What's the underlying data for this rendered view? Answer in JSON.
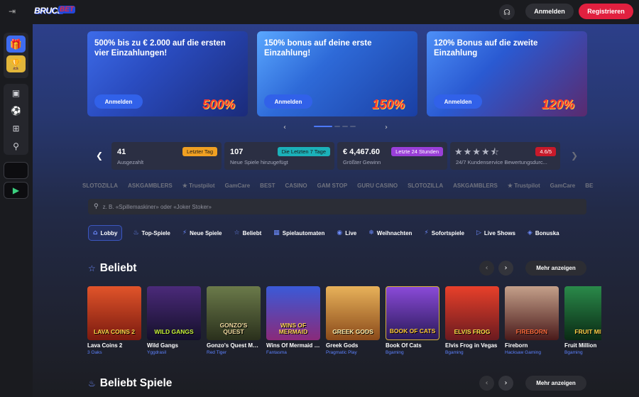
{
  "header": {
    "logo": {
      "part1": "BRUCE",
      "part2": "BET"
    },
    "login_label": "Anmelden",
    "register_label": "Registrieren"
  },
  "sidebar": {
    "promos": [
      "gift-icon",
      "trophy-icon"
    ],
    "items": [
      "slot-icon",
      "ball-icon",
      "gift-box-icon",
      "network-icon"
    ],
    "apps": [
      "apple-icon",
      "google-play-icon"
    ]
  },
  "banners": [
    {
      "title": "500% bis zu € 2.000 auf die ersten vier Einzahlungen!",
      "button": "Anmelden",
      "art": "500%"
    },
    {
      "title": "150% bonus auf deine erste Einzahlung!",
      "button": "Anmelden",
      "art": "150%"
    },
    {
      "title": "120% Bonus auf die zweite Einzahlung",
      "button": "Anmelden",
      "art": "120%"
    }
  ],
  "stats": [
    {
      "value": "41",
      "label": "Ausgezahlt",
      "badge": "Letzter Tag",
      "badge_color": "#f0a022"
    },
    {
      "value": "107",
      "label": "Neue Spiele hinzugefügt",
      "badge": "Die Letzten 7 Tage",
      "badge_color": "#1bb1b9"
    },
    {
      "value": "€ 4,467.60",
      "label": "Größter Gewinn",
      "badge": "Letzte 24 Stunden",
      "badge_color": "#9a3fd8"
    },
    {
      "value": "",
      "label": "24/7 Kundenservice Bewertungsdurc...",
      "badge": "4.6/5",
      "badge_color": "#c81a2a",
      "stars": "★★★★⯪"
    }
  ],
  "partners": [
    "SLOTOZILLA",
    "ASKGAMBLERS",
    "★ Trustpilot",
    "GamCare",
    "BEST",
    "CASINO",
    "GAM STOP",
    "GURU CASINO",
    "SLOTOZILLA",
    "ASKGAMBLERS",
    "★ Trustpilot",
    "GamCare",
    "BEST"
  ],
  "search": {
    "placeholder": "z. B. «Spillemaskiner» oder «Joker Stoker»"
  },
  "tabs": [
    {
      "icon": "⌂",
      "label": "Lobby"
    },
    {
      "icon": "♨",
      "label": "Top-Spiele"
    },
    {
      "icon": "⚡",
      "label": "Neue Spiele"
    },
    {
      "icon": "☆",
      "label": "Beliebt"
    },
    {
      "icon": "▦",
      "label": "Spielautomaten"
    },
    {
      "icon": "◉",
      "label": "Live"
    },
    {
      "icon": "❄",
      "label": "Weihnachten"
    },
    {
      "icon": "⚡",
      "label": "Sofortspiele"
    },
    {
      "icon": "▷",
      "label": "Live Shows"
    },
    {
      "icon": "◈",
      "label": "Bonuska"
    }
  ],
  "section1": {
    "title": "Beliebt",
    "more": "Mehr anzeigen"
  },
  "section2": {
    "title": "Beliebt Spiele",
    "more": "Mehr anzeigen"
  },
  "games": [
    {
      "name": "Lava Coins 2",
      "provider": "3 Oaks",
      "thumb": "LAVA COINS 2",
      "bg": "#b2281c",
      "fg": "#ffd84a"
    },
    {
      "name": "Wild Gangs",
      "provider": "Yggdrasil",
      "thumb": "WILD GANGS",
      "bg": "#2a1b4a",
      "fg": "#c6f23a"
    },
    {
      "name": "Gonzo's Quest Meg...",
      "provider": "Red Tiger",
      "thumb": "GONZO'S QUEST",
      "bg": "#3b4a2c",
      "fg": "#f1d9a0"
    },
    {
      "name": "Wins Of Mermaid M...",
      "provider": "Fantasma",
      "thumb": "WINS OF MERMAID",
      "bg": "#7b2b8a",
      "fg": "#ffd25a"
    },
    {
      "name": "Greek Gods",
      "provider": "Pragmatic Play",
      "thumb": "GREEK GODS",
      "bg": "#c07a2e",
      "fg": "#fff1b0"
    },
    {
      "name": "Book Of Cats",
      "provider": "Bgaming",
      "thumb": "BOOK OF CATS",
      "bg": "#5a2f8a",
      "fg": "#ffca3a"
    },
    {
      "name": "Elvis Frog in Vegas",
      "provider": "Bgaming",
      "thumb": "ELVIS FROG",
      "bg": "#c0282f",
      "fg": "#ffe14a"
    },
    {
      "name": "Fireborn",
      "provider": "Hacksaw Gaming",
      "thumb": "FIREBORN",
      "bg": "#5a1e23",
      "fg": "#ff6a3c"
    },
    {
      "name": "Fruit Million",
      "provider": "Bgaming",
      "thumb": "FRUIT MILL",
      "bg": "#1a5a2a",
      "fg": "#ffd14a"
    }
  ]
}
